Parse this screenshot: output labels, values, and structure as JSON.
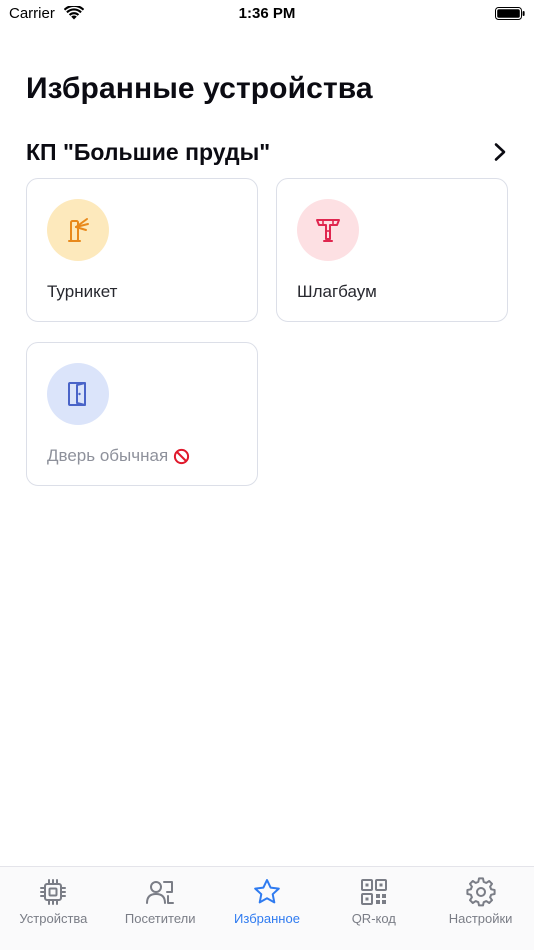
{
  "status_bar": {
    "carrier": "Carrier",
    "time": "1:36 PM"
  },
  "header": {
    "title": "Избранные устройства"
  },
  "group": {
    "title": "КП \"Большие пруды\"",
    "chevron_icon": "chevron-right-icon"
  },
  "devices": [
    {
      "label": "Турникет",
      "icon": "turnstile-icon",
      "circle_color": "#fde9bc",
      "icon_color": "#e8891c",
      "available": true
    },
    {
      "label": "Шлагбаум",
      "icon": "barrier-icon",
      "circle_color": "#fde0e3",
      "icon_color": "#e0264f",
      "available": true
    },
    {
      "label": "Дверь обычная",
      "icon": "door-icon",
      "circle_color": "#dbe4fa",
      "icon_color": "#4a64c8",
      "available": false,
      "status_icon": "blocked-icon"
    }
  ],
  "tab_bar": {
    "tabs": [
      {
        "label": "Устройства",
        "icon": "chip-icon",
        "active": false
      },
      {
        "label": "Посетители",
        "icon": "visitors-icon",
        "active": false
      },
      {
        "label": "Избранное",
        "icon": "star-icon",
        "active": true
      },
      {
        "label": "QR-код",
        "icon": "qr-code-icon",
        "active": false
      },
      {
        "label": "Настройки",
        "icon": "gear-icon",
        "active": false
      }
    ]
  },
  "colors": {
    "accent": "#2f7bf0",
    "tab_inactive": "#7a7d86",
    "blocked": "#e0192c",
    "card_border": "#dcdfe8"
  }
}
